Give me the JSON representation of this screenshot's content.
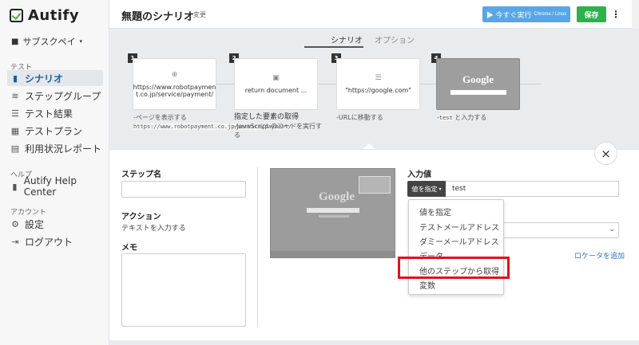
{
  "app": {
    "name": "Autify"
  },
  "sidebar": {
    "workspace": "サブスクペイ",
    "sections": {
      "test": "テスト",
      "help": "ヘルプ",
      "account": "アカウント"
    },
    "items": [
      {
        "label": "シナリオ",
        "icon": "book-icon"
      },
      {
        "label": "ステップグループ",
        "icon": "layers-icon"
      },
      {
        "label": "テスト結果",
        "icon": "list-icon"
      },
      {
        "label": "テストプラン",
        "icon": "calendar-icon"
      },
      {
        "label": "利用状況レポート",
        "icon": "report-icon"
      },
      {
        "label": "Autify Help Center",
        "icon": "book-icon"
      },
      {
        "label": "設定",
        "icon": "gear-icon"
      },
      {
        "label": "ログアウト",
        "icon": "logout-icon"
      }
    ]
  },
  "header": {
    "title": "無題のシナリオ",
    "change_label": "変更",
    "run_label": "▶ 今すぐ実行",
    "run_sub": "Chrome / Linux",
    "save_label": "保存"
  },
  "tabs": [
    {
      "label": "シナリオ"
    },
    {
      "label": "オプション"
    }
  ],
  "steps": [
    {
      "num": "1",
      "content": "https://www.robotpaymen t.co.jp/service/payment/",
      "desc_prefix": "-ページを表示する ",
      "desc_code": "https://www.robotpayment.co.jp/service/payment/"
    },
    {
      "num": "2",
      "content": "return document ...",
      "desc_title": "指定した要素の取得",
      "desc": "-JavaScript のコードを実行する"
    },
    {
      "num": "3",
      "content": "\"https://google.com\"",
      "desc": "-URLに移動する"
    },
    {
      "num": "4",
      "content": "Google",
      "desc_prefix": "-",
      "desc_code": "test",
      "desc_suffix": " と入力する"
    }
  ],
  "panel": {
    "step_name_label": "ステップ名",
    "action_label": "アクション",
    "action_value": "テキストを入力する",
    "memo_label": "メモ",
    "input_value_label": "入力値",
    "value_button": "値を指定",
    "value_text": "test",
    "add_locator": "ロケータを追加",
    "dropdown": [
      "値を指定",
      "テストメールアドレス",
      "ダミーメールアドレス",
      "データ",
      "他のステップから取得",
      "変数"
    ],
    "screenshot_logo": "Google"
  }
}
